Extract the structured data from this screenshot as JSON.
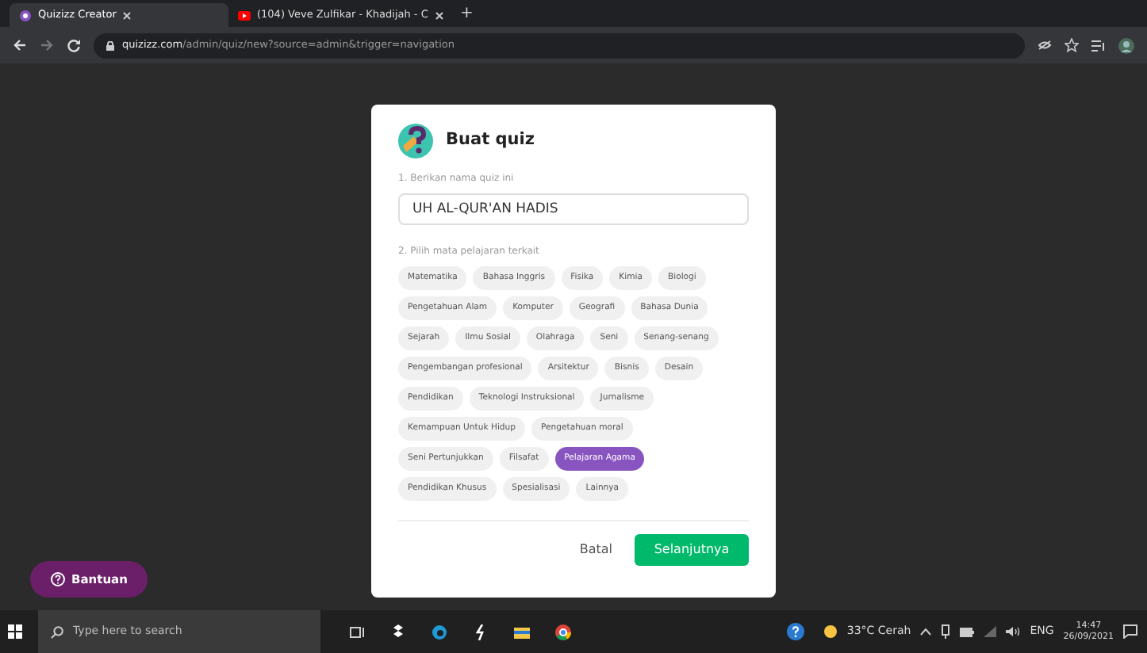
{
  "browser": {
    "tabs": [
      {
        "title": "Quizizz Creator",
        "selected": true,
        "kind": "quizizz"
      },
      {
        "title": "(104) Veve Zulfikar - Khadijah - C",
        "selected": false,
        "kind": "video"
      }
    ],
    "new_tab": "+",
    "address": {
      "host": "quizizz.com",
      "path": "/admin/quiz/new?source=admin&trigger=navigation"
    }
  },
  "dialog": {
    "title": "Buat quiz",
    "name_label": "1. Berikan nama quiz ini",
    "name_value": "UH AL-QUR'AN HADIS",
    "subject_label": "2. Pilih mata pelajaran terkait",
    "subject_rows": [
      [
        {
          "label": "Matematika",
          "selected": false
        },
        {
          "label": "Bahasa Inggris",
          "selected": false
        },
        {
          "label": "Fisika",
          "selected": false
        },
        {
          "label": "Kimia",
          "selected": false
        },
        {
          "label": "Biologi",
          "selected": false
        }
      ],
      [
        {
          "label": "Pengetahuan Alam",
          "selected": false
        },
        {
          "label": "Komputer",
          "selected": false
        },
        {
          "label": "Geografi",
          "selected": false
        },
        {
          "label": "Bahasa Dunia",
          "selected": false
        }
      ],
      [
        {
          "label": "Sejarah",
          "selected": false
        },
        {
          "label": "Ilmu Sosial",
          "selected": false
        },
        {
          "label": "Olahraga",
          "selected": false
        },
        {
          "label": "Seni",
          "selected": false
        },
        {
          "label": "Senang-senang",
          "selected": false
        }
      ],
      [
        {
          "label": "Pengembangan profesional",
          "selected": false
        },
        {
          "label": "Arsitektur",
          "selected": false
        },
        {
          "label": "Bisnis",
          "selected": false
        },
        {
          "label": "Desain",
          "selected": false
        }
      ],
      [
        {
          "label": "Pendidikan",
          "selected": false
        },
        {
          "label": "Teknologi Instruksional",
          "selected": false
        },
        {
          "label": "Jurnalisme",
          "selected": false
        }
      ],
      [
        {
          "label": "Kemampuan Untuk Hidup",
          "selected": false
        },
        {
          "label": "Pengetahuan moral",
          "selected": false
        }
      ],
      [
        {
          "label": "Seni Pertunjukkan",
          "selected": false
        },
        {
          "label": "Filsafat",
          "selected": false
        },
        {
          "label": "Pelajaran Agama",
          "selected": true
        }
      ],
      [
        {
          "label": "Pendidikan Khusus",
          "selected": false
        },
        {
          "label": "Spesialisasi",
          "selected": false
        },
        {
          "label": "Lainnya",
          "selected": false
        }
      ]
    ],
    "cancel": "Batal",
    "next": "Selanjutnya"
  },
  "help_button": "Bantuan",
  "taskbar": {
    "search_placeholder": "Type here to search",
    "weather": "33°C Cerah",
    "language": "ENG",
    "time": "14:47",
    "date": "26/09/2021"
  }
}
